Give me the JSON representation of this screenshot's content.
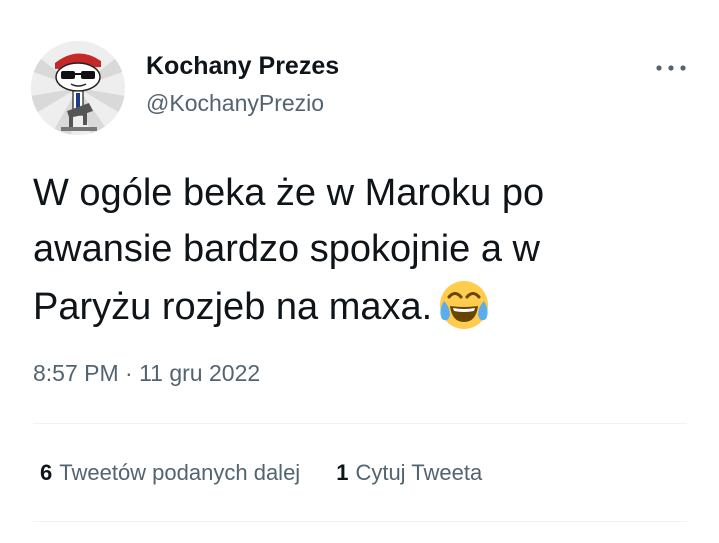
{
  "tweet": {
    "author": {
      "display_name": "Kochany Prezes",
      "handle": "@KochanyPrezio",
      "avatar": "avatar-cartoon-sunglasses"
    },
    "more_icon": "more-horizontal-icon",
    "text_lines": [
      "W ogóle beka że w Maroku po",
      "awansie bardzo spokojnie a w",
      "Paryżu rozjeb na maxa."
    ],
    "emoji": "face-with-tears-of-joy-icon",
    "timestamp": "8:57 PM · 11 gru 2022",
    "stats": {
      "retweets_count": "6",
      "retweets_label": "Tweetów podanych dalej",
      "quotes_count": "1",
      "quotes_label": "Cytuj Tweeta"
    }
  },
  "colors": {
    "text_primary": "#0f1419",
    "text_secondary": "#536471",
    "divider": "#eff3f4",
    "emoji_yellow": "#ffcc4d",
    "emoji_tears": "#5dadec"
  }
}
